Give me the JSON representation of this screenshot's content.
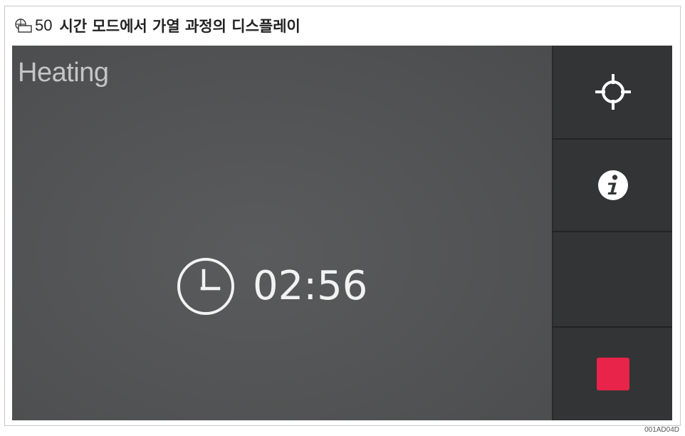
{
  "figure": {
    "number": "50",
    "title": "시간 모드에서 가열 과정의 디스플레이",
    "image_code": "001AD04D"
  },
  "screen": {
    "state_label": "Heating",
    "timer_value": "02:56",
    "timer_icon": "clock-icon"
  },
  "sidebar": {
    "buttons": [
      {
        "icon": "crosshair-icon"
      },
      {
        "icon": "info-icon"
      },
      {
        "icon": ""
      },
      {
        "icon": "stop-icon",
        "color": "#e8244a"
      }
    ]
  },
  "colors": {
    "screen_bg": "#545556",
    "sidebar_bg": "#333435",
    "stop_accent": "#e8244a",
    "text_light": "#f2f2f2"
  }
}
